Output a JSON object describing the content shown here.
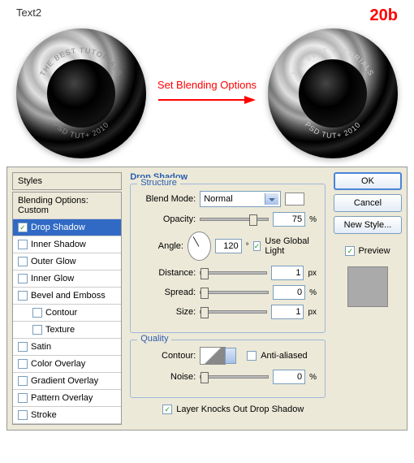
{
  "top": {
    "text2": "Text2",
    "step": "20b",
    "arrow_label": "Set Blending Options",
    "lens_top_text": "THE BEST TUTORIALS",
    "lens_bottom_text": "PSD TUT+ 2010"
  },
  "styles": {
    "header": "Styles",
    "blend_opts": "Blending Options: Custom",
    "items": [
      {
        "label": "Drop Shadow",
        "checked": true,
        "selected": true
      },
      {
        "label": "Inner Shadow",
        "checked": false
      },
      {
        "label": "Outer Glow",
        "checked": false
      },
      {
        "label": "Inner Glow",
        "checked": false
      },
      {
        "label": "Bevel and Emboss",
        "checked": false
      },
      {
        "label": "Contour",
        "checked": false,
        "indent": true
      },
      {
        "label": "Texture",
        "checked": false,
        "indent": true
      },
      {
        "label": "Satin",
        "checked": false
      },
      {
        "label": "Color Overlay",
        "checked": false
      },
      {
        "label": "Gradient Overlay",
        "checked": false
      },
      {
        "label": "Pattern Overlay",
        "checked": false
      },
      {
        "label": "Stroke",
        "checked": false
      }
    ]
  },
  "panel": {
    "title": "Drop Shadow",
    "structure": {
      "legend": "Structure",
      "blend_mode_label": "Blend Mode:",
      "blend_mode_value": "Normal",
      "opacity_label": "Opacity:",
      "opacity_value": "75",
      "opacity_unit": "%",
      "angle_label": "Angle:",
      "angle_value": "120",
      "angle_unit": "°",
      "global_light": "Use Global Light",
      "global_light_checked": true,
      "distance_label": "Distance:",
      "distance_value": "1",
      "distance_unit": "px",
      "spread_label": "Spread:",
      "spread_value": "0",
      "spread_unit": "%",
      "size_label": "Size:",
      "size_value": "1",
      "size_unit": "px"
    },
    "quality": {
      "legend": "Quality",
      "contour_label": "Contour:",
      "anti_aliased": "Anti-aliased",
      "anti_aliased_checked": false,
      "noise_label": "Noise:",
      "noise_value": "0",
      "noise_unit": "%"
    },
    "knockout": "Layer Knocks Out Drop Shadow",
    "knockout_checked": true
  },
  "buttons": {
    "ok": "OK",
    "cancel": "Cancel",
    "new_style": "New Style...",
    "preview": "Preview",
    "preview_checked": true
  }
}
